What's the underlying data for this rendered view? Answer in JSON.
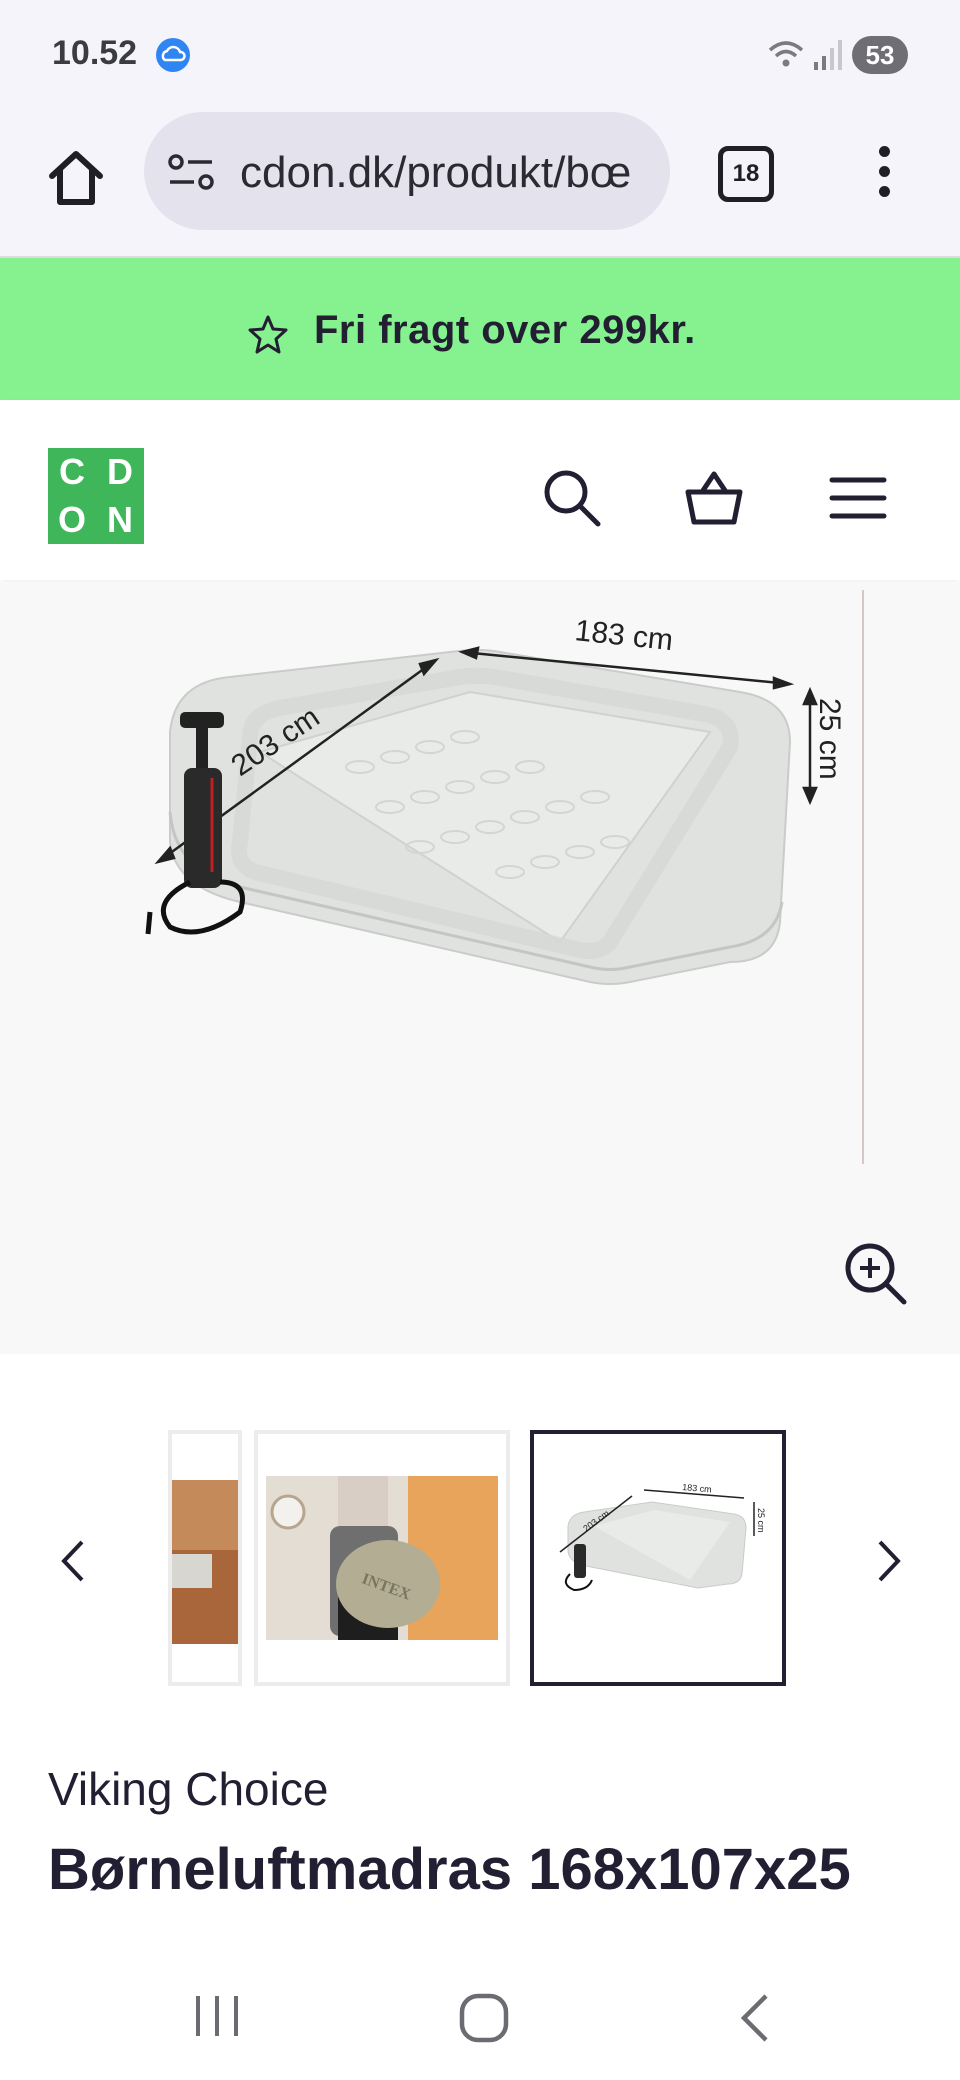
{
  "status": {
    "time": "10.52",
    "battery": "53"
  },
  "browser": {
    "url": "cdon.dk/produkt/bœ",
    "tab_count": "18"
  },
  "promo": {
    "text": "Fri fragt over 299kr."
  },
  "site": {
    "logo_letters": [
      "C",
      "D",
      "O",
      "N"
    ]
  },
  "gallery": {
    "dim_length": "203 cm",
    "dim_width": "183 cm",
    "dim_height": "25 cm",
    "thumb_bag_text": "INTEX",
    "thumb_dim_length": "203 cm",
    "thumb_dim_width": "183 cm",
    "thumb_dim_height": "25 cm",
    "selected_index": 3,
    "prev_icon": "chevron-left-icon",
    "next_icon": "chevron-right-icon"
  },
  "product": {
    "brand": "Viking Choice",
    "title": "Børneluftmadras 168x107x25"
  },
  "colors": {
    "promo_bg": "#85f28f",
    "logo_bg": "#3fb65a",
    "text_dark": "#221f33"
  }
}
